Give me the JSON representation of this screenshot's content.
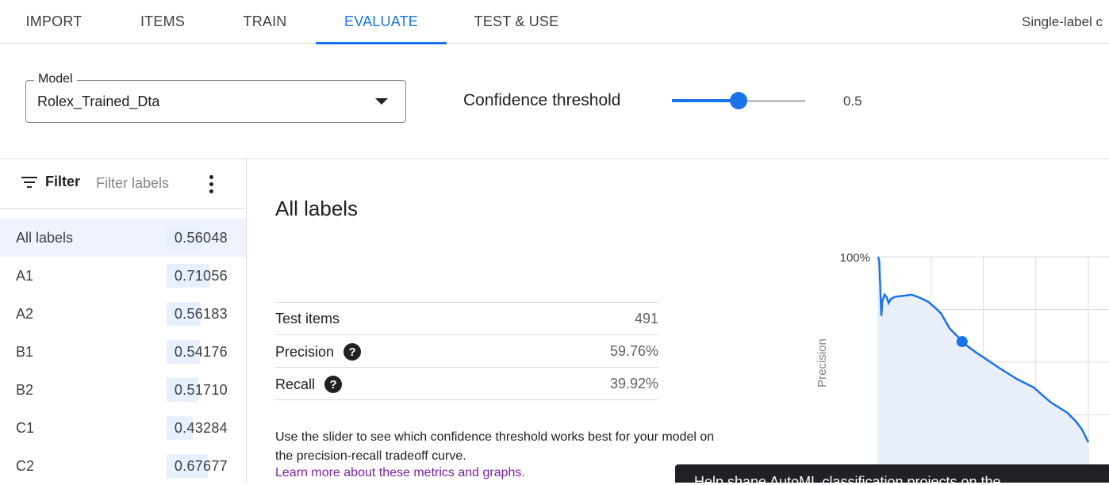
{
  "tabs": [
    {
      "label": "IMPORT"
    },
    {
      "label": "ITEMS"
    },
    {
      "label": "TRAIN"
    },
    {
      "label": "EVALUATE"
    },
    {
      "label": "TEST & USE"
    }
  ],
  "active_tab": "EVALUATE",
  "header_right_text": "Single-label c",
  "model_select": {
    "legend": "Model",
    "value": "Rolex_Trained_Dta"
  },
  "confidence": {
    "label": "Confidence threshold",
    "value": "0.5",
    "fraction": 0.5
  },
  "filter": {
    "button_label": "Filter",
    "placeholder": "Filter labels",
    "menu_icon": "more-vert-icon"
  },
  "labels": [
    {
      "name": "All labels",
      "score": "0.56048",
      "value": 0.56048,
      "selected": true
    },
    {
      "name": "A1",
      "score": "0.71056",
      "value": 0.71056
    },
    {
      "name": "A2",
      "score": "0.56183",
      "value": 0.56183
    },
    {
      "name": "B1",
      "score": "0.54176",
      "value": 0.54176
    },
    {
      "name": "B2",
      "score": "0.51710",
      "value": 0.5171
    },
    {
      "name": "C1",
      "score": "0.43284",
      "value": 0.43284
    },
    {
      "name": "C2",
      "score": "0.67677",
      "value": 0.67677
    }
  ],
  "main": {
    "title": "All labels",
    "stats": {
      "test_items": {
        "label": "Test items",
        "value": "491"
      },
      "precision": {
        "label": "Precision",
        "value": "59.76%"
      },
      "recall": {
        "label": "Recall",
        "value": "39.92%"
      }
    },
    "description": "Use the slider to see which confidence threshold works best for your model on the precision-recall tradeoff curve.",
    "learn_more": "Learn more about these metrics and graphs."
  },
  "snackbar_text": "Help shape AutoML classification projects on the",
  "colors": {
    "accent": "#1a73e8",
    "link": "#7b1fa2",
    "chart_fill": "#e8eefa"
  },
  "chart_data": {
    "type": "area",
    "ylabel": "Precision",
    "y_tick_labels": [
      "100%"
    ],
    "xlim": [
      0,
      1
    ],
    "ylim": [
      0,
      1
    ],
    "grid": true,
    "x": [
      0.0,
      0.005,
      0.01,
      0.015,
      0.02,
      0.03,
      0.04,
      0.05,
      0.06,
      0.08,
      0.12,
      0.16,
      0.2,
      0.24,
      0.28,
      0.3,
      0.34,
      0.38,
      0.39924,
      0.42,
      0.46,
      0.52,
      0.58,
      0.66,
      0.74,
      0.82,
      0.9,
      0.94,
      0.97,
      1.0
    ],
    "y": [
      1.0,
      0.98,
      0.86,
      0.72,
      0.79,
      0.82,
      0.81,
      0.78,
      0.8,
      0.81,
      0.815,
      0.82,
      0.805,
      0.785,
      0.75,
      0.73,
      0.66,
      0.62,
      0.5976,
      0.58,
      0.55,
      0.51,
      0.47,
      0.42,
      0.38,
      0.31,
      0.26,
      0.22,
      0.18,
      0.12
    ],
    "marker": {
      "x": 0.39924,
      "y": 0.5976
    }
  }
}
